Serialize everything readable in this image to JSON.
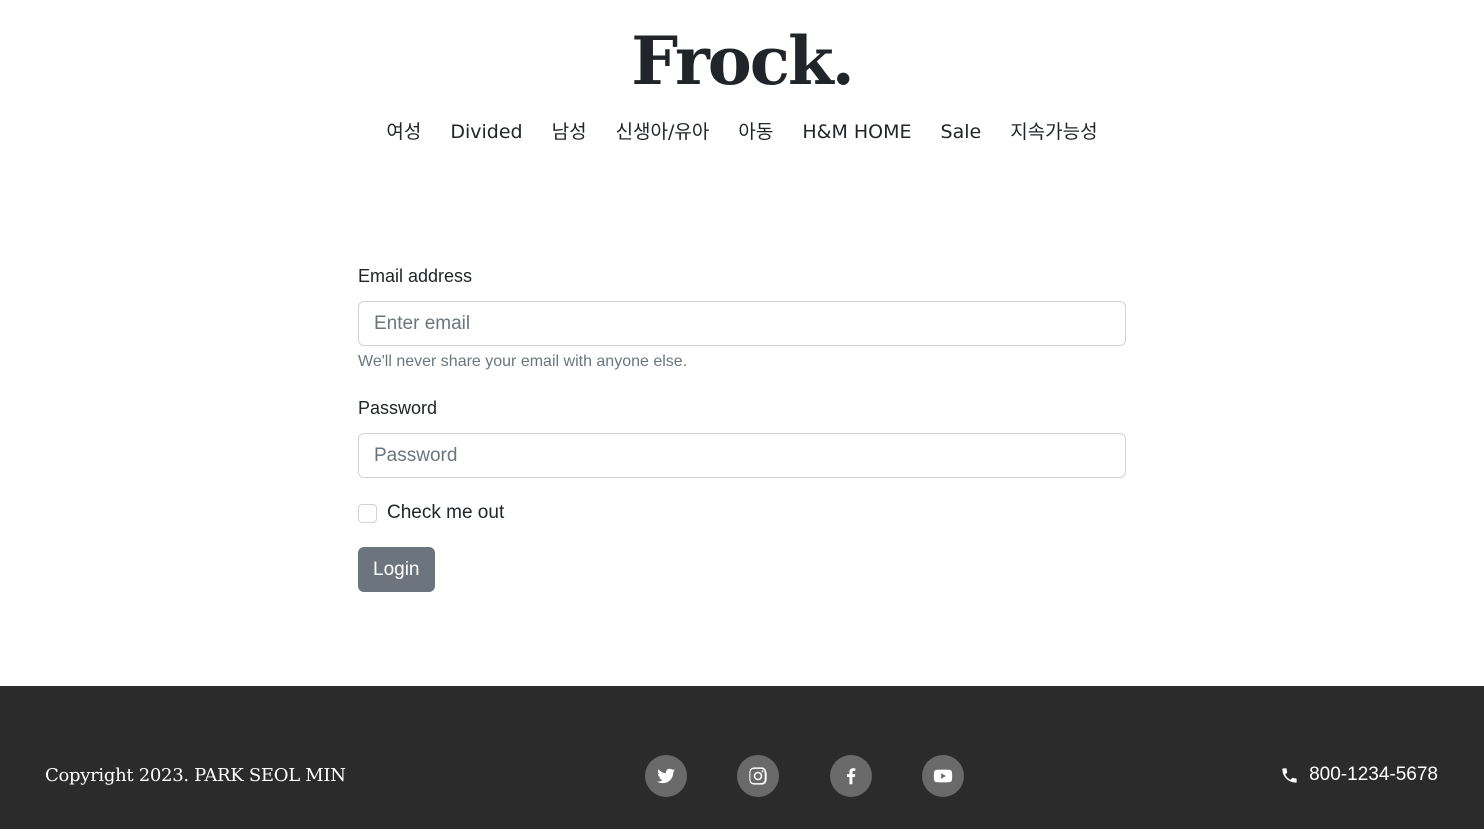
{
  "header": {
    "brand": "Frock.",
    "nav": [
      "여성",
      "Divided",
      "남성",
      "신생아/유아",
      "아동",
      "H&M HOME",
      "Sale",
      "지속가능성"
    ]
  },
  "form": {
    "email_label": "Email address",
    "email_placeholder": "Enter email",
    "email_help": "We'll never share your email with anyone else.",
    "password_label": "Password",
    "password_placeholder": "Password",
    "checkbox_label": "Check me out",
    "checkbox_checked": false,
    "submit_label": "Login"
  },
  "footer": {
    "copyright": "Copyright 2023. PARK SEOL MIN",
    "social": [
      "twitter-icon",
      "instagram-icon",
      "facebook-icon",
      "youtube-icon"
    ],
    "phone": "800-1234-5678",
    "background": "#2b2b2b"
  },
  "colors": {
    "button": "#6c757d",
    "text": "#212529",
    "muted": "#6c757d"
  }
}
